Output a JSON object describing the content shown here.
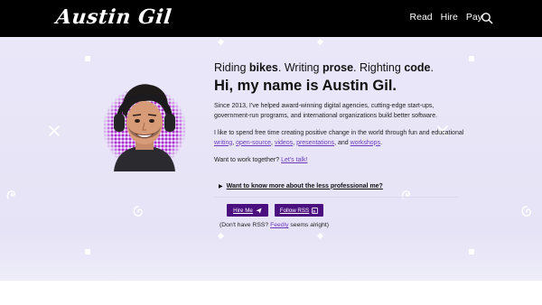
{
  "header": {
    "logo_text": "Austin Gil",
    "nav": [
      {
        "label": "Read"
      },
      {
        "label": "Hire"
      },
      {
        "label": "Pay"
      }
    ],
    "search_icon": "search-icon"
  },
  "hero": {
    "tagline": {
      "pre1": "Riding ",
      "b1": "bikes",
      "pre2": ". Writing ",
      "b2": "prose",
      "pre3": ". Righting ",
      "b3": "code",
      "post": "."
    },
    "heading": "Hi, my name is Austin Gil.",
    "intro": "Since 2013, I've helped award-winning digital agencies, cutting-edge start-ups, government-run programs, and international organizations build better software.",
    "change": {
      "text": "I like to spend free time creating positive change in the world through fun and educational",
      "links": [
        "writing",
        "open-source",
        "videos",
        "presentations",
        "workshops"
      ],
      "sep1": ", ",
      "sep_and": ", and ",
      "end": "."
    },
    "work": {
      "text": "Want to work together?",
      "link": "Let's talk!"
    },
    "details_summary": "Want to know more about the less professional me?",
    "buttons": {
      "hire": "Hire Me",
      "follow": "Follow RSS"
    },
    "rss_note": {
      "pre": "(Don't have RSS?",
      "link": "Feedly",
      "post": "seems alright)"
    }
  },
  "colors": {
    "header_bg": "#000000",
    "hero_bg": "#e7e5f7",
    "button_bg": "#4b0f80",
    "link": "#6c3bbd",
    "avatar_dots": "#b32ad1"
  }
}
